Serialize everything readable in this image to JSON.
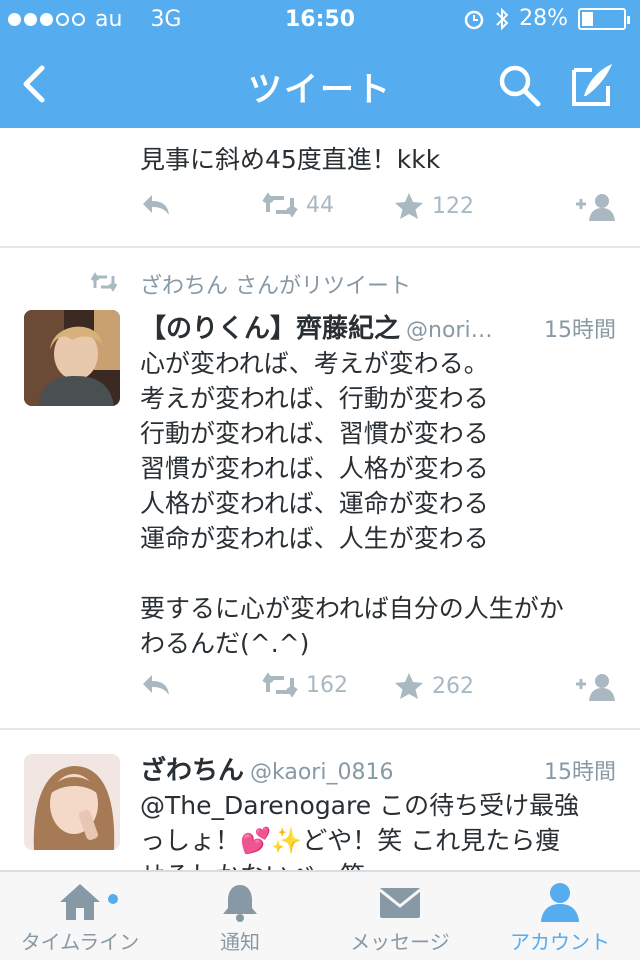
{
  "colors": {
    "accent": "#55acee",
    "text": "#292f33",
    "muted": "#8899a6",
    "icon": "#aab8c2"
  },
  "statusbar": {
    "carrier": "au",
    "network": "3G",
    "time": "16:50",
    "battery": "28%",
    "battery_level": 0.28
  },
  "navbar": {
    "title": "ツイート",
    "icons": [
      "back-icon",
      "search-icon",
      "compose-icon"
    ]
  },
  "tweets": [
    {
      "text": "見事に斜め45度直進！kkk",
      "retweets": "44",
      "favorites": "122"
    },
    {
      "retweeted_by": "ざわちん さんがリツイート",
      "name": "【のりくん】齊藤紀之",
      "handle": "@nori…",
      "time": "15時間",
      "text": "心が変われば、考えが変わる。\n考えが変われば、行動が変わる\n行動が変われば、習慣が変わる\n習慣が変われば、人格が変わる\n人格が変われば、運命が変わる\n運命が変われば、人生が変わる\n\n要するに心が変われば自分の人生がか\nわるんだ(^.^)",
      "retweets": "162",
      "favorites": "262"
    },
    {
      "name": "ざわちん",
      "handle": "@kaori_0816",
      "time": "15時間",
      "text": "@The_Darenogare この待ち受け最強\nっしょ！💕✨どや！笑 これ見たら痩\nせるしかないべ～笑"
    }
  ],
  "tabs": [
    {
      "label": "タイムライン",
      "icon": "home-icon"
    },
    {
      "label": "通知",
      "icon": "bell-icon"
    },
    {
      "label": "メッセージ",
      "icon": "envelope-icon"
    },
    {
      "label": "アカウント",
      "icon": "person-icon"
    }
  ]
}
